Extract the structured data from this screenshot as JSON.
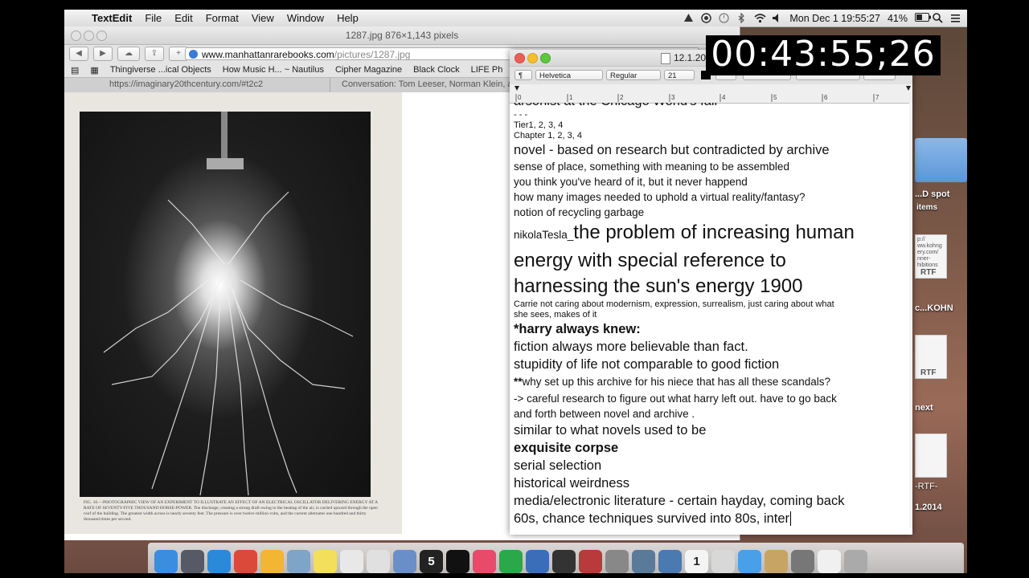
{
  "menubar": {
    "app_name": "TextEdit",
    "items": [
      "File",
      "Edit",
      "Format",
      "View",
      "Window",
      "Help"
    ],
    "battery": "41%",
    "clock": "Mon Dec 1  19:55:27"
  },
  "browser": {
    "title": "1287.jpg 876×1,143 pixels",
    "url_host": "www.manhattanrarebooks.com",
    "url_path": "/pictures/1287.jpg",
    "bookmarks": [
      "Thingiverse ...ical Objects",
      "How Music H... ~ Nautilus",
      "Cipher Magazine",
      "Black Clock",
      "LIFE Ph"
    ],
    "tabs": [
      "https://imaginary20thcentury.com/#t2c2",
      "Conversation: Tom Leeser, Norman Klein, a"
    ],
    "caption": "FIG. 10.—PHOTOGRAPHIC VIEW OF AN EXPERIMENT TO ILLUSTRATE AN EFFECT OF AN ELECTRICAL OSCILLATOR DELIVERING ENERGY AT A RATE OF SEVENTY-FIVE THOUSAND HORSE-POWER. The discharge, creating a strong draft owing to the heating of the air, is carried upward through the open roof of the building. The greatest width across is nearly seventy feet. The pressure is over twelve million volts, and the current alternates one hundred and thirty thousand times per second."
  },
  "textedit": {
    "title": "12.1.20",
    "font_family": "Helvetica",
    "font_style": "Regular",
    "font_size": "21",
    "ruler_marks": [
      "0",
      "1",
      "2",
      "3",
      "4",
      "5",
      "6",
      "7"
    ],
    "lines": [
      {
        "text": "arsonist at the Chicago World's fair",
        "size": "s16",
        "bold": false
      },
      {
        "text": "- - -",
        "size": "s9",
        "bold": false
      },
      {
        "text": "Tier1, 2, 3, 4",
        "size": "s9",
        "bold": false
      },
      {
        "text": "Chapter 1, 2, 3, 4",
        "size": "s9",
        "bold": false
      },
      {
        "text": "novel - based on research but contradicted by archive",
        "size": "s16",
        "bold": false
      },
      {
        "text": "sense of place, something with meaning to be assembled",
        "size": "s12",
        "bold": false
      },
      {
        "text": "you think you've heard of it, but it never happend",
        "size": "s12",
        "bold": false
      },
      {
        "text": "how many images needed to uphold a virtual reality/fantasy?",
        "size": "s12",
        "bold": false
      },
      {
        "text": "notion of recycling garbage",
        "size": "s12",
        "bold": false
      }
    ],
    "tesla_prefix": "nikolaTesla_",
    "tesla_lines": [
      "the problem of increasing human",
      "energy with special reference to",
      "harnessing the sun's energy 1900"
    ],
    "lines2": [
      {
        "text": "Carrie not caring about modernism, expression, surrealism, just caring about what",
        "size": "s9",
        "bold": false
      },
      {
        "text": "she sees, makes of it",
        "size": "s9",
        "bold": false
      },
      {
        "text": "*harry always knew:",
        "size": "s16",
        "bold": true
      },
      {
        "text": "fiction always more believable than fact.",
        "size": "s16",
        "bold": false
      },
      {
        "text": "stupidity of life not comparable to good fiction",
        "size": "s16",
        "bold": false
      }
    ],
    "why_prefix": "**",
    "why_text": "why set up this archive for his niece that has all these scandals?",
    "lines3": [
      {
        "text": "-> careful research to figure out what harry left out. have to go back",
        "size": "s12",
        "bold": false
      },
      {
        "text": "and forth between novel and archive .",
        "size": "s12",
        "bold": false
      },
      {
        "text": "similar to what novels used to be",
        "size": "s16",
        "bold": false
      },
      {
        "text": "exquisite corpse",
        "size": "s16",
        "bold": true
      },
      {
        "text": "serial selection",
        "size": "s16",
        "bold": false
      },
      {
        "text": "historical weirdness",
        "size": "s16",
        "bold": false
      },
      {
        "text": "media/electronic literature - certain hayday, coming back",
        "size": "s16",
        "bold": false
      },
      {
        "text": "60s, chance techniques survived into 80s, inter",
        "size": "s16",
        "bold": false
      }
    ]
  },
  "timer": "00:43:55;26",
  "desktop": {
    "labels": [
      "...D spot",
      "items",
      "c...KOHN",
      "next",
      "-RTF-",
      "1.2014"
    ],
    "doc_snippets": [
      "p:// ww.kohng ery.com/ nner- hibitions",
      "",
      ""
    ],
    "rtf_label": "RTF"
  },
  "dock": {
    "items": [
      {
        "name": "finder-icon",
        "color": "#3b8de0",
        "glyph": ""
      },
      {
        "name": "launchpad-icon",
        "color": "#555a66",
        "glyph": ""
      },
      {
        "name": "safari-icon",
        "color": "#2b89d9",
        "glyph": ""
      },
      {
        "name": "chrome-icon",
        "color": "#d94a3a",
        "glyph": ""
      },
      {
        "name": "google-drive-icon",
        "color": "#f2b632",
        "glyph": ""
      },
      {
        "name": "preview-icon",
        "color": "#7ea4c8",
        "glyph": ""
      },
      {
        "name": "stickies-icon",
        "color": "#f3df5a",
        "glyph": ""
      },
      {
        "name": "textedit-icon",
        "color": "#e8e8e8",
        "glyph": ""
      },
      {
        "name": "notes-icon",
        "color": "#e0e0e0",
        "glyph": ""
      },
      {
        "name": "xcode-icon",
        "color": "#6a8fc8",
        "glyph": ""
      },
      {
        "name": "five-icon",
        "color": "#222222",
        "glyph": "5"
      },
      {
        "name": "ustream-live-icon",
        "color": "#111111",
        "glyph": ""
      },
      {
        "name": "itunes-icon",
        "color": "#e84a6a",
        "glyph": ""
      },
      {
        "name": "spotify-icon",
        "color": "#2aa84a",
        "glyph": ""
      },
      {
        "name": "quicktime-icon",
        "color": "#3a6fb8",
        "glyph": ""
      },
      {
        "name": "final-cut-icon",
        "color": "#333333",
        "glyph": ""
      },
      {
        "name": "photo-booth-icon",
        "color": "#b83a3a",
        "glyph": ""
      },
      {
        "name": "automator-icon",
        "color": "#888888",
        "glyph": ""
      },
      {
        "name": "image-capture-icon",
        "color": "#5a7a9a",
        "glyph": ""
      },
      {
        "name": "iphoto-icon",
        "color": "#4a7ab0",
        "glyph": ""
      },
      {
        "name": "calendar-icon",
        "color": "#f4f4f4",
        "glyph": "1"
      },
      {
        "name": "preview-doc-icon",
        "color": "#d8d8d8",
        "glyph": ""
      },
      {
        "name": "messages-icon",
        "color": "#4aa0e8",
        "glyph": ""
      },
      {
        "name": "folder-icon",
        "color": "#c8a464",
        "glyph": ""
      },
      {
        "name": "system-preferences-icon",
        "color": "#777777",
        "glyph": ""
      },
      {
        "name": "document-icon",
        "color": "#f0f0f0",
        "glyph": ""
      },
      {
        "name": "trash-icon",
        "color": "#aaaaaa",
        "glyph": ""
      }
    ]
  }
}
